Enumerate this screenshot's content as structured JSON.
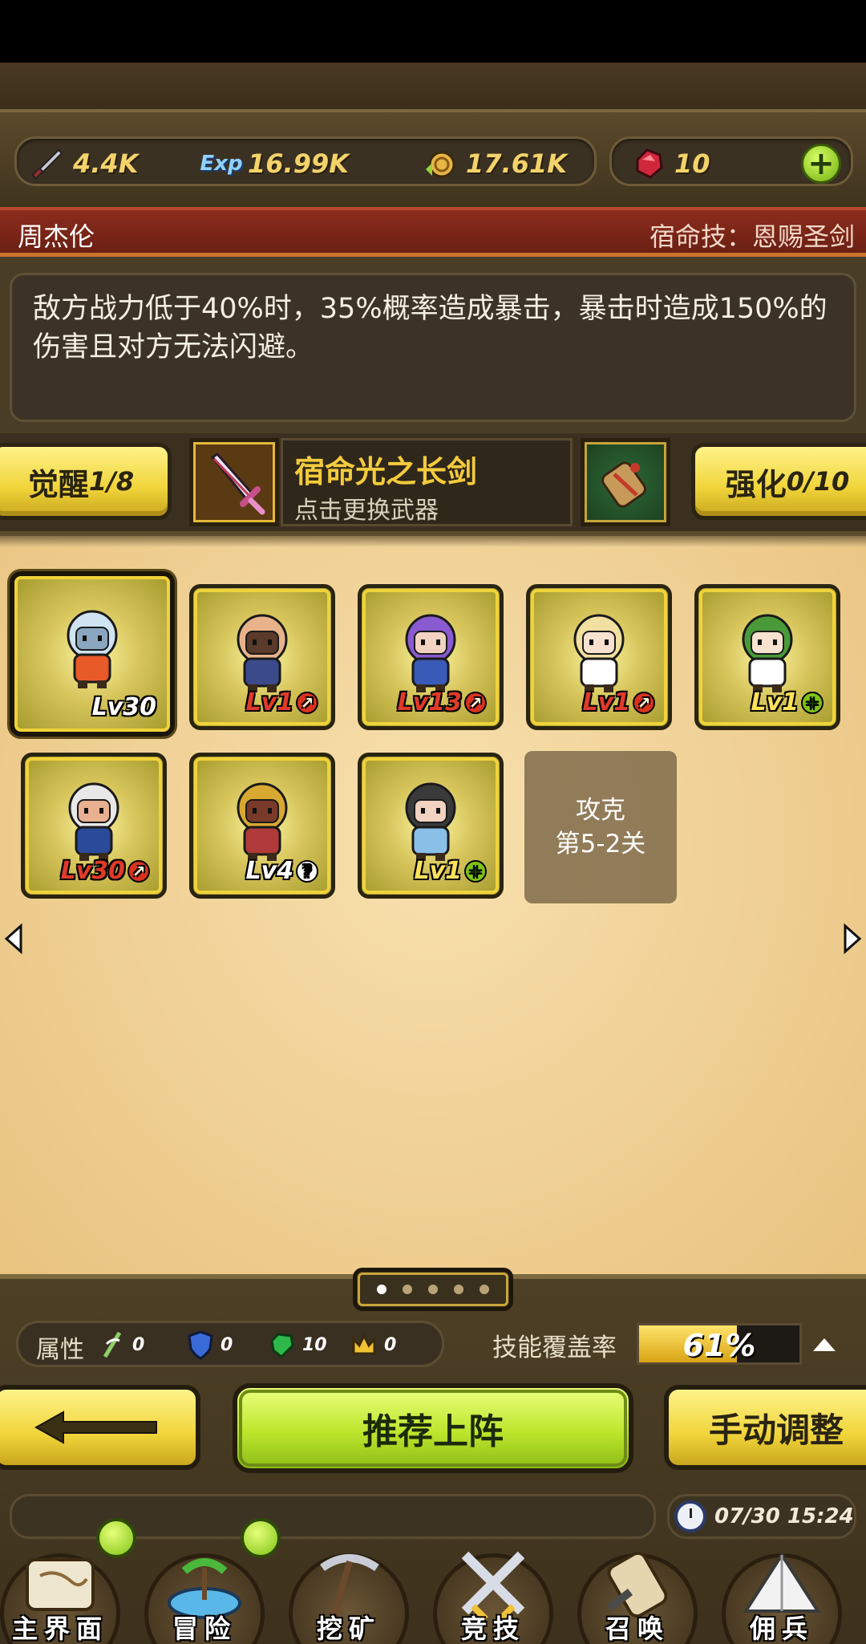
{
  "resources": {
    "attack": {
      "icon": "sword-icon",
      "value": "4.4K"
    },
    "exp": {
      "icon": "exp-icon",
      "label": "Exp",
      "value": "16.99K"
    },
    "coin": {
      "icon": "coin-icon",
      "value": "17.61K"
    },
    "gem": {
      "icon": "ruby-icon",
      "value": "10"
    },
    "add_label": "+"
  },
  "hero": {
    "name": "周杰伦",
    "destiny_skill": "宿命技：恩赐圣剑",
    "description": "敌方战力低于40%时，35%概率造成暴击，暴击时造成150%的伤害且对方无法闪避。"
  },
  "weapon_row": {
    "awaken_label": "觉醒",
    "awaken_value": "1/8",
    "weapon_name": "宿命光之长剑",
    "weapon_hint": "点击更换武器",
    "enhance_label": "强化",
    "enhance_value": "0/10"
  },
  "heroes": [
    {
      "name": "polar-bear",
      "level": "Lv30",
      "badge": "",
      "selected": true
    },
    {
      "name": "bearded-warrior",
      "level": "Lv1",
      "badge": "up",
      "selected": false
    },
    {
      "name": "purple-hair-girl",
      "level": "Lv13",
      "badge": "up",
      "selected": false
    },
    {
      "name": "blonde-girl",
      "level": "Lv1",
      "badge": "up",
      "selected": false
    },
    {
      "name": "green-hair-girl",
      "level": "Lv1",
      "badge": "plus",
      "selected": false
    },
    {
      "name": "maid-grandpa",
      "level": "Lv30",
      "badge": "up",
      "selected": false
    },
    {
      "name": "golden-knight",
      "level": "Lv4",
      "badge": "question",
      "selected": false
    },
    {
      "name": "dark-hair-girl",
      "level": "Lv1",
      "badge": "plus",
      "selected": false
    }
  ],
  "locked_slot": {
    "line1": "攻克",
    "line2": "第5-2关"
  },
  "pager": {
    "count": 5,
    "active": 0
  },
  "attributes": {
    "label": "属性",
    "items": [
      {
        "icon": "wind-icon",
        "value": "0"
      },
      {
        "icon": "shield-icon",
        "value": "0"
      },
      {
        "icon": "emerald-icon",
        "value": "10"
      },
      {
        "icon": "crown-icon",
        "value": "0"
      }
    ]
  },
  "skill_coverage": {
    "label": "技能覆盖率",
    "percent": 61,
    "text": "61%"
  },
  "actions": {
    "back": "←",
    "recommend": "推荐上阵",
    "manual": "手动调整"
  },
  "status": {
    "time": "07/30 15:24"
  },
  "nav": [
    {
      "label": "主界面",
      "icon": "map-scroll-icon",
      "notify": true
    },
    {
      "label": "冒险",
      "icon": "island-icon",
      "notify": true
    },
    {
      "label": "挖矿",
      "icon": "pickaxe-icon",
      "notify": false
    },
    {
      "label": "竞技",
      "icon": "crossed-swords-icon",
      "notify": false
    },
    {
      "label": "召唤",
      "icon": "summon-scroll-icon",
      "notify": false
    },
    {
      "label": "佣兵",
      "icon": "tent-icon",
      "notify": false
    }
  ],
  "colors": {
    "gold": "#f0d43a",
    "green": "#bde62c",
    "hero_bar": "#8d2c1c",
    "parchment": "#f0d196"
  }
}
